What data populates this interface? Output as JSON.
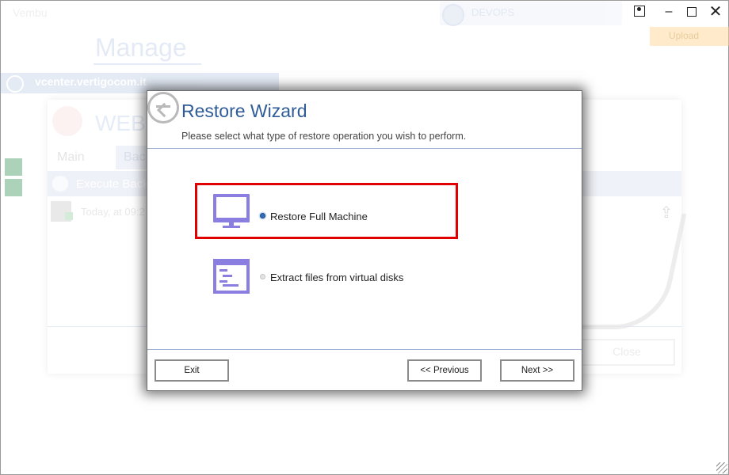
{
  "app": {
    "brand_tab": "Vembu",
    "search_text": "DEVOPS",
    "orange_button": "Upload",
    "manage_title": "Manage",
    "vcenter_label": "vcenter.vertigocom.it"
  },
  "backup_window": {
    "title": "WEBC",
    "tabs": {
      "main": "Main",
      "back": "Bac"
    },
    "execute_label": "Execute Back",
    "row_text": "Today, at 09:2",
    "close_label": "Close"
  },
  "wizard": {
    "title": "Restore Wizard",
    "subtitle": "Please select what type of restore operation you wish to perform.",
    "options": [
      {
        "label": "Restore Full Machine",
        "selected": true,
        "icon": "monitor-icon"
      },
      {
        "label": "Extract files from virtual disks",
        "selected": false,
        "icon": "document-icon"
      }
    ],
    "buttons": {
      "exit": "Exit",
      "previous": "<< Previous",
      "next": "Next >>"
    }
  },
  "colors": {
    "accent": "#2f5c98",
    "icon_purple": "#8a7fe0",
    "highlight": "#e00000",
    "radio_selected": "#2f6eb8"
  }
}
